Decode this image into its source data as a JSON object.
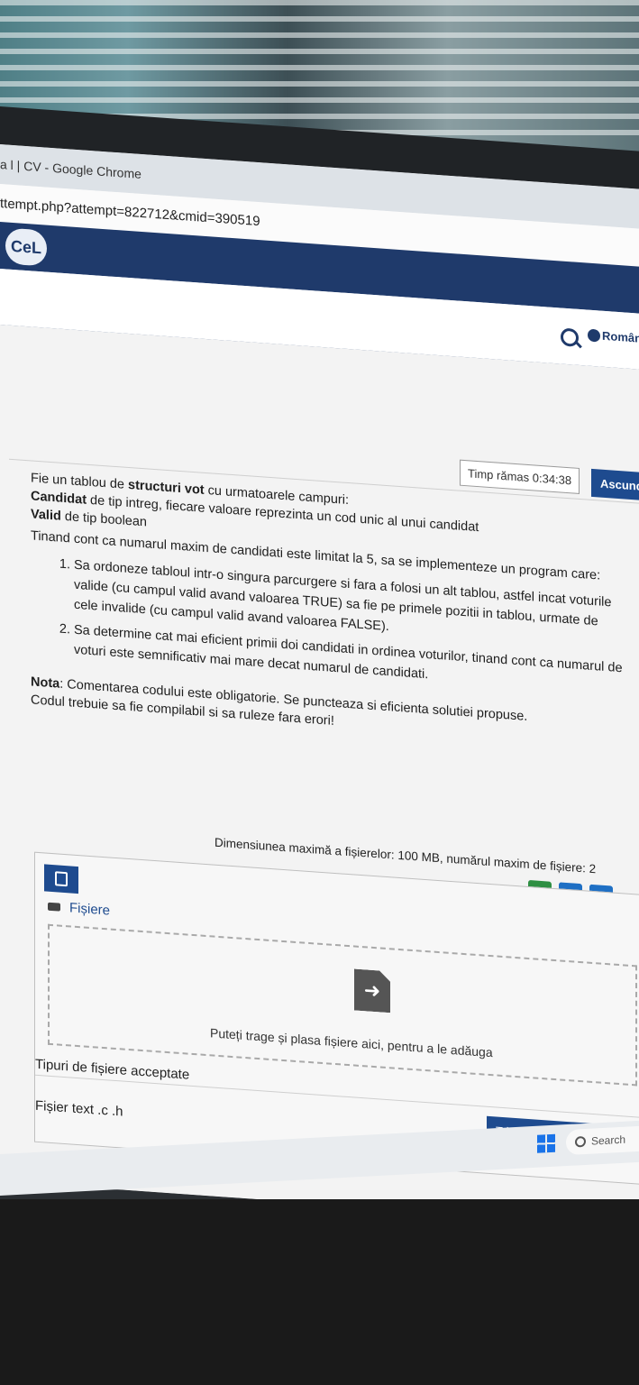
{
  "browser": {
    "title": "a l | CV - Google Chrome",
    "url": "ttempt.php?attempt=822712&cmid=390519"
  },
  "site": {
    "logo_text": "CeL",
    "language": "Român"
  },
  "quiz": {
    "timer": "Timp rămas 0:34:38",
    "hide_button": "Ascunde",
    "intro_a": "Fie un tablou de ",
    "intro_bold": "structuri vot",
    "intro_b": " cu urmatoarele campuri:",
    "field1_bold": "Candidat",
    "field1_rest": " de tip intreg, fiecare valoare reprezinta un cod unic al unui candidat",
    "field2_bold": "Valid",
    "field2_rest": " de tip boolean",
    "task_intro": "Tinand cont ca numarul maxim de candidati este limitat la 5, sa se implementeze un program care:",
    "items": [
      "Sa ordoneze tabloul intr-o singura parcurgere si fara a folosi un alt tablou, astfel incat voturile valide (cu campul valid avand valoarea TRUE) sa fie pe primele pozitii in tablou, urmate de cele invalide (cu campul valid avand valoarea FALSE).",
      "Sa determine cat mai eficient primii doi candidati in ordinea voturilor, tinand cont ca numarul de voturi este semnificativ mai mare decat numarul de candidati."
    ],
    "note_bold": "Nota",
    "note_rest": ": Comentarea codului este obligatorie. Se puncteaza si eficienta solutiei propuse.",
    "note_line2": "Codul trebuie sa fie compilabil si sa ruleze fara erori!"
  },
  "upload": {
    "meta": "Dimensiunea maximă a fișierelor: 100 MB, numărul maxim de fișiere: 2",
    "files_label": "Fișiere",
    "drop_text": "Puteți trage și plasa fișiere aici, pentru a le adăuga",
    "accepted_title": "Tipuri de fișiere acceptate",
    "accepted_types": "Fișier text .c .h"
  },
  "submit_button": "Trimite testul pentru evaluare",
  "taskbar": {
    "search_label": "Search"
  },
  "colors": {
    "accent": "#1e4b8f",
    "site_header": "#1f3a6b"
  }
}
